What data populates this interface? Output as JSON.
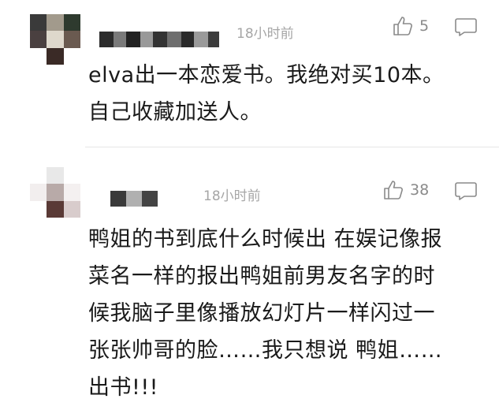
{
  "comments": [
    {
      "time": "18小时前",
      "likes": "5",
      "lines": [
        "elva出一本恋爱书。我绝对买10本。",
        "自己收藏加送人。"
      ]
    },
    {
      "time": "18小时前",
      "likes": "38",
      "lines": [
        "鸭姐的书到底什么时候出 在娱记像报",
        "菜名一样的报出鸭姐前男友名字的时",
        "候我脑子里像播放幻灯片一样闪过一",
        "张张帅哥的脸……我只想说 鸭姐……",
        "出书!!!"
      ]
    }
  ],
  "icons": {
    "like": "thumbs-up-icon",
    "reply": "comment-bubble-icon"
  },
  "colors": {
    "meta_text": "#a6a6a6",
    "icon": "#8a8a8a",
    "body_text": "#1a1a1a",
    "divider": "#e6e6e6"
  }
}
